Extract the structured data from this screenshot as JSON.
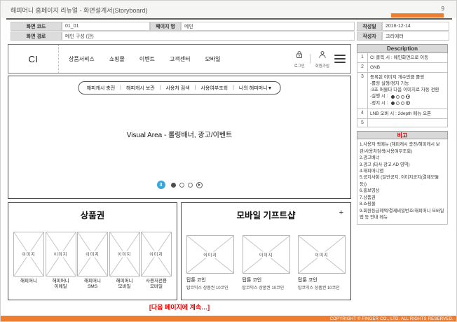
{
  "header": {
    "title": "해피머니 홈페이지 리뉴얼 - 화면설계서(Storyboard)",
    "page_number": "9"
  },
  "info_table": {
    "screen_code_label": "화면 코드",
    "screen_code_value": "01_01",
    "page_name_label": "페이지 명",
    "page_name_value": "메인",
    "date_label": "작성일",
    "date_value": "2016-12-14",
    "screen_path_label": "화면 경로",
    "screen_path_value": "메인 구성 (안)",
    "author_label": "작성자",
    "author_value": "크리에터"
  },
  "wireframe": {
    "logo": "CI",
    "nav_items": [
      "상품서비스",
      "쇼핑몰",
      "이벤트",
      "고객센터",
      "모바일"
    ],
    "login_label": "로그인",
    "signup_label": "회원가입",
    "quick_menu": {
      "separator": "|",
      "items": [
        "해피캐시 충전",
        "해피캐시 보관",
        "사용처 검색",
        "사용여부조회",
        "나의 해피머니▼"
      ]
    },
    "visual_area_label": "Visual Area - 롤링배너, 광고/이벤트",
    "annotation_marker": "3",
    "gift_section": {
      "title": "상품권",
      "placeholder_label": "이미지",
      "items": [
        {
          "line1": "해피머니",
          "line2": ""
        },
        {
          "line1": "해피머니",
          "line2": "이메일"
        },
        {
          "line1": "해피머니",
          "line2": "SMS"
        },
        {
          "line1": "해피머니",
          "line2": "모바일"
        },
        {
          "line1": "사용처전용",
          "line2": "모바일"
        }
      ]
    },
    "mobile_gift_section": {
      "title": "모바일 기프트샵",
      "more_label": "+",
      "placeholder_label": "이미지",
      "items": [
        {
          "name": "탑툰 코인",
          "desc": "탑코믹스 상품권 10코인"
        },
        {
          "name": "탑툰 코인",
          "desc": "탑코믹스 상품권 10코인"
        },
        {
          "name": "탑툰 코인",
          "desc": "탑코믹스 상품권 10코인"
        }
      ]
    },
    "continuation_note": "[다음 페이지에 계속…]"
  },
  "description_panel": {
    "title": "Description",
    "rows": [
      {
        "no": "1",
        "text": "CI 클릭 시 : 메인화면으로 이동"
      },
      {
        "no": "2",
        "text": "GNB"
      },
      {
        "no": "3",
        "line1": "등록된 이미지 개수만큼 롤링",
        "line2": "-롤링 실행/정지 기능",
        "line3": "-3초 머물다 다음 이미지로 자동 전환",
        "line4": "-실행 시 :",
        "line5": "-정지 시 :"
      },
      {
        "no": "4",
        "text": "LNB 오버 시 : 2depth 메뉴 오픈"
      },
      {
        "no": "5",
        "text": ""
      }
    ],
    "notes": {
      "title": "비고",
      "items": [
        "1.사용자 퀵메뉴 (해피캐시 충전/해피캐시 보관/사용처검색/사용여부조회)",
        "2.광고배너",
        "3.광고 (타사 광고 AD 영역)",
        "4.해피머니앱",
        "5.공지사항 (일반공지, 이미지공지(결제모듈 등))",
        "6.홍보영상",
        "7.상품권",
        "8.쇼핑몰",
        "9.회원등급혜택/결제비밀번호/해피머니 모바일앱 등 안내 메뉴"
      ]
    }
  },
  "footer": {
    "copyright": "COPYRIGHT © FINGER CO., LTD. ALL RIGHTS RESERVED."
  },
  "colors": {
    "accent_orange": "#ED7D31",
    "note_red": "#C00000",
    "marker_blue": "#35A8DF"
  }
}
